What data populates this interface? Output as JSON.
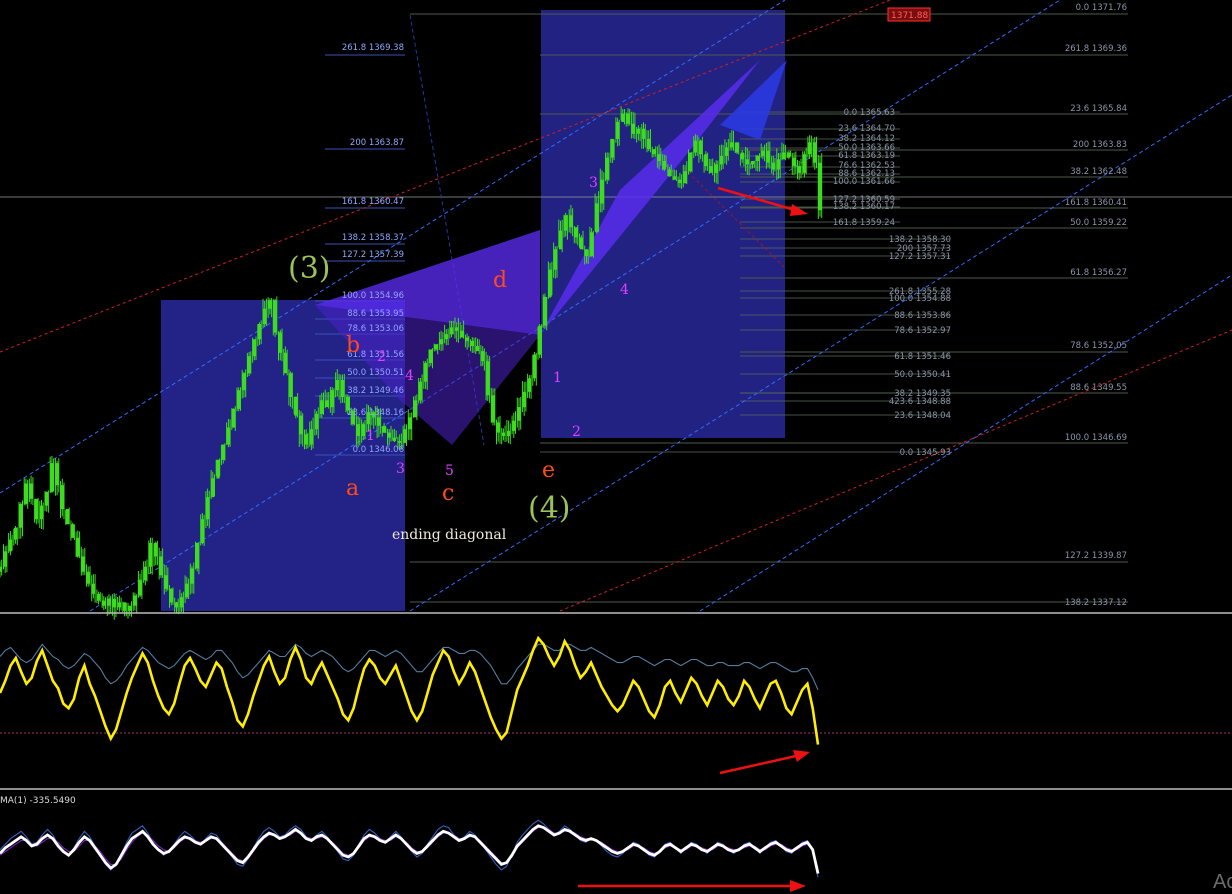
{
  "chart_data": [
    {
      "type": "candlestick",
      "panel": "price",
      "title": "",
      "ylim": [
        1336.5,
        1372.5
      ],
      "top_price_badge": "1371.88",
      "colors": {
        "candle": "#3ddc1f",
        "fib_left": "#8fa6ff",
        "fib_right": "#8a94a8",
        "channel_blue": "#2f6bff",
        "channel_red": "#d11f1f",
        "box_fill": "#28289a",
        "pattern_fill": "#5a2cf0",
        "wave_green": "#9bc25a",
        "wave_orange": "#ff4a1a",
        "wave_magenta": "#e040ff",
        "arrow": "#ee1111"
      },
      "close_series": [
        1339.2,
        1340.1,
        1340.8,
        1341.5,
        1342.9,
        1344.1,
        1343.2,
        1342.0,
        1342.8,
        1343.6,
        1345.3,
        1344.0,
        1342.6,
        1341.7,
        1340.9,
        1339.8,
        1338.9,
        1338.2,
        1337.6,
        1337.2,
        1336.9,
        1337.3,
        1336.8,
        1337.1,
        1336.6,
        1336.9,
        1337.5,
        1338.4,
        1339.2,
        1340.6,
        1339.8,
        1338.7,
        1337.9,
        1337.1,
        1336.8,
        1337.4,
        1338.2,
        1339.1,
        1340.6,
        1342.0,
        1343.3,
        1344.4,
        1345.5,
        1346.4,
        1347.4,
        1348.5,
        1349.6,
        1350.6,
        1351.6,
        1352.6,
        1353.5,
        1354.4,
        1354.9,
        1353.0,
        1351.8,
        1350.6,
        1349.2,
        1348.1,
        1347.0,
        1346.4,
        1347.3,
        1348.2,
        1349.0,
        1348.6,
        1349.6,
        1350.2,
        1349.2,
        1348.4,
        1347.6,
        1346.9,
        1347.6,
        1348.3,
        1348.0,
        1347.5,
        1347.1,
        1346.8,
        1346.6,
        1346.5,
        1347.3,
        1348.0,
        1349.0,
        1350.1,
        1351.2,
        1352.0,
        1352.3,
        1352.6,
        1352.9,
        1353.3,
        1353.1,
        1352.7,
        1352.5,
        1352.2,
        1351.9,
        1351.3,
        1349.3,
        1347.7,
        1347.1,
        1346.9,
        1347.2,
        1347.8,
        1348.6,
        1349.5,
        1350.3,
        1351.7,
        1353.4,
        1355.1,
        1356.7,
        1357.9,
        1359.0,
        1359.9,
        1359.2,
        1358.6,
        1357.9,
        1357.5,
        1358.9,
        1360.6,
        1362.0,
        1363.3,
        1364.4,
        1365.4,
        1365.9,
        1365.3,
        1364.7,
        1365.0,
        1364.4,
        1363.8,
        1363.5,
        1363.1,
        1362.6,
        1362.2,
        1362.0,
        1361.8,
        1362.5,
        1363.6,
        1364.3,
        1363.5,
        1362.8,
        1362.4,
        1362.9,
        1363.4,
        1363.9,
        1364.2,
        1363.6,
        1363.2,
        1362.9,
        1363.1,
        1363.4,
        1363.7,
        1363.0,
        1362.6,
        1363.2,
        1363.6,
        1363.3,
        1362.8,
        1362.4,
        1363.5,
        1364.2,
        1363.0,
        1360.2
      ],
      "fib_levels_left": [
        "261.8 1369.38",
        "200 1363.87",
        "161.8 1360.47",
        "138.2 1358.37",
        "127.2 1357.39",
        "100.0 1354.96",
        "88.6 1353.95",
        "78.6 1353.06",
        "61.8 1351.56",
        "50.0 1350.51",
        "38.2 1349.46",
        "23.6 1348.16",
        "0.0 1346.06"
      ],
      "fib_levels_right": [
        "0.0 1371.76",
        "261.8 1369.36",
        "23.6 1365.84",
        "200 1363.83",
        "38.2 1362.48",
        "161.8 1360.41",
        "50.0 1359.22",
        "61.8 1356.27",
        "78.6 1352.05",
        "88.6 1349.55",
        "100.0 1346.69",
        "127.2 1339.87",
        "138.2 1337.12"
      ],
      "fib_levels_mid": [
        "0.0 1365.63",
        "23.6 1364.70",
        "38.2 1364.12",
        "50.0 1363.66",
        "61.8 1363.19",
        "76.6 1362.53",
        "88.6 1362.13",
        "100.0 1361.66",
        "127.2 1360.59",
        "138.2 1360.17",
        "161.8 1359.24",
        "138.2 1358.30",
        "200 1357.73",
        "127.2 1357.31",
        "261.8 1355.28",
        "100.0 1354.88",
        "88.6 1353.86",
        "78.6 1352.97",
        "61.8 1351.46",
        "50.0 1350.41",
        "38.2 1349.35",
        "423.6 1348.88",
        "23.6 1348.04",
        "0.0 1345.93"
      ],
      "wave_labels": {
        "primary": [
          "(3)",
          "(4)"
        ],
        "abcde": [
          "a",
          "b",
          "c",
          "d",
          "e"
        ],
        "sub": [
          "1",
          "2",
          "3",
          "4",
          "5",
          "1",
          "2",
          "3",
          "4"
        ]
      },
      "annotation": "ending diagonal"
    },
    {
      "type": "line",
      "panel": "oscillator",
      "title": "",
      "color": "#ffee00",
      "values": [
        52,
        60,
        70,
        75,
        66,
        58,
        62,
        73,
        80,
        70,
        60,
        55,
        45,
        42,
        48,
        62,
        70,
        58,
        50,
        40,
        30,
        22,
        28,
        40,
        52,
        62,
        70,
        78,
        72,
        60,
        50,
        42,
        38,
        45,
        58,
        70,
        75,
        68,
        60,
        56,
        64,
        72,
        68,
        56,
        46,
        34,
        30,
        38,
        50,
        60,
        70,
        76,
        66,
        58,
        62,
        74,
        82,
        74,
        62,
        58,
        66,
        72,
        64,
        56,
        48,
        38,
        34,
        42,
        56,
        68,
        74,
        70,
        62,
        58,
        64,
        70,
        60,
        50,
        40,
        34,
        40,
        52,
        64,
        72,
        80,
        76,
        66,
        58,
        64,
        72,
        66,
        56,
        46,
        36,
        28,
        22,
        26,
        40,
        54,
        62,
        70,
        80,
        88,
        84,
        76,
        70,
        76,
        86,
        80,
        70,
        62,
        66,
        72,
        64,
        56,
        50,
        44,
        40,
        44,
        52,
        60,
        56,
        48,
        40,
        36,
        44,
        56,
        60,
        52,
        46,
        54,
        62,
        58,
        50,
        44,
        52,
        60,
        56,
        48,
        44,
        50,
        60,
        56,
        48,
        42,
        50,
        58,
        60,
        52,
        42,
        38,
        46,
        54,
        58,
        42,
        18
      ],
      "series": [
        {
          "name": "",
          "values": [
            76,
            80,
            82,
            78,
            74,
            72,
            74,
            79,
            84,
            80,
            76,
            74,
            70,
            68,
            70,
            74,
            78,
            76,
            72,
            68,
            62,
            58,
            60,
            64,
            70,
            74,
            78,
            82,
            80,
            76,
            72,
            70,
            68,
            70,
            74,
            78,
            80,
            78,
            76,
            74,
            76,
            80,
            80,
            76,
            72,
            66,
            62,
            64,
            68,
            72,
            76,
            80,
            78,
            76,
            76,
            80,
            84,
            82,
            78,
            76,
            78,
            80,
            78,
            76,
            72,
            68,
            66,
            68,
            72,
            76,
            80,
            80,
            78,
            76,
            78,
            80,
            78,
            74,
            70,
            66,
            66,
            70,
            74,
            78,
            82,
            82,
            80,
            78,
            78,
            80,
            80,
            78,
            74,
            70,
            64,
            58,
            58,
            62,
            68,
            72,
            76,
            80,
            84,
            84,
            82,
            80,
            80,
            84,
            84,
            82,
            80,
            80,
            82,
            80,
            78,
            76,
            74,
            72,
            72,
            74,
            76,
            76,
            74,
            72,
            70,
            72,
            74,
            74,
            72,
            70,
            72,
            74,
            74,
            72,
            70,
            70,
            72,
            72,
            70,
            70,
            70,
            72,
            72,
            70,
            68,
            70,
            72,
            72,
            70,
            68,
            66,
            66,
            68,
            68,
            62,
            54
          ]
        }
      ]
    },
    {
      "type": "line",
      "panel": "ma",
      "title": "MA(1) -335.5490",
      "color": "#ffffff",
      "values": [
        42,
        48,
        52,
        56,
        60,
        56,
        50,
        52,
        58,
        62,
        58,
        50,
        44,
        40,
        46,
        54,
        60,
        56,
        48,
        40,
        32,
        26,
        30,
        40,
        50,
        58,
        62,
        66,
        60,
        52,
        46,
        42,
        44,
        50,
        56,
        60,
        58,
        54,
        52,
        56,
        60,
        58,
        52,
        46,
        40,
        34,
        32,
        38,
        46,
        54,
        60,
        64,
        62,
        58,
        60,
        64,
        68,
        64,
        58,
        56,
        60,
        62,
        58,
        52,
        46,
        40,
        38,
        42,
        50,
        58,
        62,
        60,
        56,
        54,
        58,
        62,
        58,
        52,
        46,
        42,
        44,
        50,
        56,
        62,
        66,
        64,
        60,
        56,
        58,
        62,
        60,
        54,
        48,
        42,
        36,
        30,
        32,
        40,
        50,
        56,
        62,
        68,
        72,
        70,
        66,
        62,
        64,
        68,
        66,
        62,
        58,
        56,
        58,
        56,
        52,
        48,
        44,
        42,
        44,
        48,
        52,
        50,
        46,
        42,
        40,
        44,
        50,
        52,
        48,
        44,
        48,
        52,
        50,
        46,
        44,
        48,
        52,
        50,
        46,
        44,
        46,
        50,
        52,
        48,
        44,
        48,
        52,
        54,
        50,
        46,
        44,
        48,
        52,
        54,
        46,
        20
      ],
      "series": [
        {
          "name": "",
          "values": [
            46,
            52,
            58,
            62,
            66,
            60,
            52,
            54,
            62,
            68,
            62,
            52,
            44,
            40,
            48,
            58,
            66,
            60,
            50,
            40,
            30,
            24,
            30,
            42,
            54,
            64,
            68,
            72,
            64,
            54,
            46,
            40,
            44,
            52,
            60,
            66,
            62,
            56,
            52,
            58,
            64,
            62,
            54,
            46,
            38,
            30,
            28,
            36,
            48,
            58,
            66,
            70,
            66,
            60,
            62,
            68,
            72,
            68,
            60,
            56,
            62,
            66,
            60,
            52,
            44,
            36,
            34,
            40,
            52,
            62,
            68,
            64,
            58,
            54,
            60,
            66,
            60,
            52,
            44,
            38,
            42,
            52,
            60,
            68,
            72,
            70,
            62,
            56,
            60,
            66,
            62,
            54,
            46,
            38,
            30,
            24,
            28,
            40,
            54,
            62,
            68,
            74,
            78,
            74,
            68,
            62,
            66,
            72,
            68,
            62,
            56,
            54,
            58,
            56,
            50,
            44,
            40,
            38,
            42,
            48,
            54,
            52,
            46,
            40,
            38,
            44,
            52,
            54,
            48,
            42,
            48,
            54,
            52,
            46,
            42,
            48,
            54,
            52,
            46,
            42,
            46,
            52,
            54,
            48,
            42,
            48,
            54,
            56,
            50,
            44,
            42,
            48,
            54,
            56,
            44,
            16
          ]
        },
        {
          "name": "",
          "values": [
            40,
            44,
            48,
            52,
            56,
            56,
            52,
            50,
            54,
            58,
            58,
            54,
            48,
            44,
            44,
            50,
            56,
            56,
            50,
            44,
            36,
            30,
            30,
            36,
            46,
            54,
            60,
            64,
            62,
            56,
            50,
            46,
            44,
            48,
            54,
            58,
            58,
            56,
            54,
            56,
            58,
            58,
            54,
            48,
            42,
            36,
            34,
            36,
            44,
            52,
            58,
            62,
            62,
            60,
            60,
            62,
            66,
            64,
            60,
            58,
            58,
            60,
            58,
            54,
            48,
            42,
            40,
            42,
            48,
            56,
            60,
            60,
            58,
            56,
            56,
            60,
            58,
            54,
            48,
            44,
            44,
            48,
            54,
            60,
            64,
            64,
            62,
            58,
            58,
            60,
            60,
            56,
            50,
            44,
            38,
            32,
            32,
            38,
            48,
            54,
            60,
            66,
            70,
            70,
            68,
            64,
            64,
            66,
            66,
            64,
            60,
            58,
            58,
            56,
            54,
            50,
            46,
            44,
            44,
            46,
            50,
            50,
            48,
            44,
            42,
            44,
            48,
            50,
            48,
            46,
            46,
            50,
            50,
            48,
            46,
            46,
            50,
            50,
            48,
            46,
            46,
            48,
            50,
            50,
            46,
            46,
            50,
            52,
            52,
            48,
            46,
            46,
            50,
            52,
            46,
            26
          ]
        }
      ]
    }
  ],
  "watermark": "Ac"
}
